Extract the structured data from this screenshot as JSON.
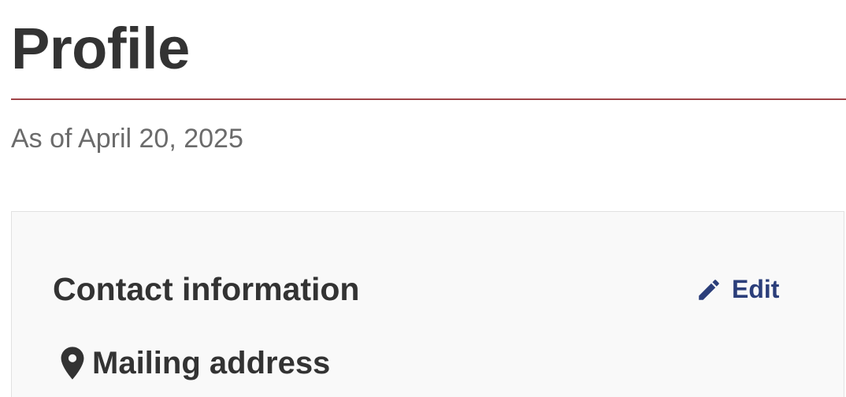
{
  "header": {
    "title": "Profile",
    "as_of": "As of April 20, 2025"
  },
  "contact_card": {
    "title": "Contact information",
    "edit_label": "Edit",
    "edit_icon": "pencil-icon",
    "mailing_section": {
      "heading": "Mailing address",
      "icon": "map-pin-icon"
    }
  },
  "colors": {
    "title_rule": "#a04448",
    "link": "#2b3e7a",
    "heading_text": "#333333",
    "muted_text": "#6b6b6b",
    "card_background": "#f9f9f9"
  }
}
